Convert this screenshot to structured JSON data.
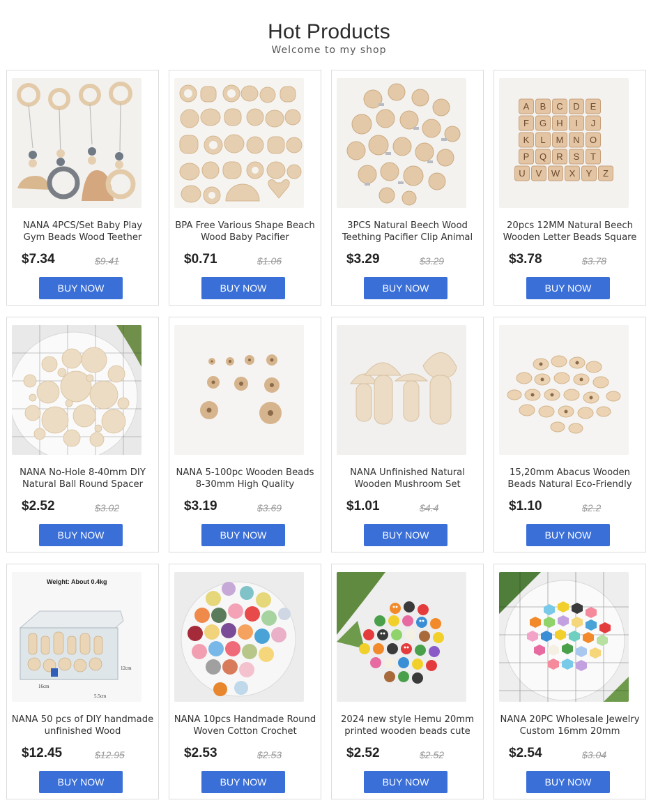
{
  "header": {
    "title": "Hot Products",
    "subtitle": "Welcome to my shop"
  },
  "buy_label": "BUY NOW",
  "products": [
    {
      "name": "NANA 4PCS/Set Baby Play Gym Beads Wood Teether",
      "price": "$7.34",
      "old_price": "$9.41"
    },
    {
      "name": "BPA Free Various Shape Beach Wood Baby Pacifier",
      "price": "$0.71",
      "old_price": "$1.06"
    },
    {
      "name": "3PCS Natural Beech Wood Teething Pacifier Clip Animal",
      "price": "$3.29",
      "old_price": "$3.29"
    },
    {
      "name": "20pcs 12MM Natural Beech Wooden Letter Beads Square",
      "price": "$3.78",
      "old_price": "$3.78"
    },
    {
      "name": "NANA No-Hole 8-40mm DIY Natural Ball Round Spacer",
      "price": "$2.52",
      "old_price": "$3.02"
    },
    {
      "name": "NANA 5-100pc Wooden Beads 8-30mm High Quality",
      "price": "$3.19",
      "old_price": "$3.69"
    },
    {
      "name": "NANA Unfinished Natural Wooden Mushroom Set",
      "price": "$1.01",
      "old_price": "$4.4"
    },
    {
      "name": "15,20mm Abacus Wooden Beads Natural Eco-Friendly",
      "price": "$1.10",
      "old_price": "$2.2"
    },
    {
      "name": "NANA 50 pcs of DIY handmade unfinished Wood",
      "price": "$12.45",
      "old_price": "$12.95"
    },
    {
      "name": "NANA 10pcs Handmade Round Woven Cotton Crochet",
      "price": "$2.53",
      "old_price": "$2.53"
    },
    {
      "name": "2024 new style Hemu 20mm printed wooden beads cute",
      "price": "$2.52",
      "old_price": "$2.52"
    },
    {
      "name": "NANA 20PC Wholesale Jewelry Custom 16mm 20mm",
      "price": "$2.54",
      "old_price": "$3.04"
    }
  ],
  "image_text": {
    "letters": [
      "A",
      "B",
      "C",
      "D",
      "E",
      "F",
      "G",
      "H",
      "I",
      "J",
      "K",
      "L",
      "M",
      "N",
      "O",
      "P",
      "Q",
      "R",
      "S",
      "T",
      "U",
      "V",
      "W",
      "X",
      "Y",
      "Z"
    ],
    "weight_label": "Weight: About 0.4kg",
    "dim_12": "12cm",
    "dim_16": "16cm",
    "dim_55": "5.5cm"
  },
  "colors": {
    "button": "#3a6fd8",
    "wood": "#e6cfb0",
    "wood_dark": "#c9a77f"
  }
}
